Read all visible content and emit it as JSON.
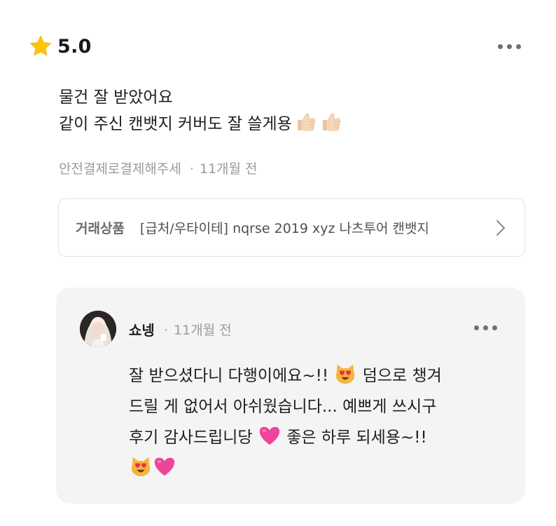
{
  "review": {
    "rating": "5.0",
    "icons": {
      "rating": "star-icon",
      "more": "more-horizontal-icon"
    },
    "text_lines": [
      "물건 잘 받았어요",
      "같이 주신 캔뱃지 커버도 잘 쓸게용"
    ],
    "trailing_emoji": [
      "thumbs-up",
      "thumbs-up"
    ],
    "author": "안전결제로결제해주세",
    "separator": "·",
    "time": "11개월 전"
  },
  "product": {
    "label": "거래상품",
    "name": "[급처/우타이테] nqrse 2019 xyz 나츠투어 캔뱃지"
  },
  "reply": {
    "author": "쇼넹",
    "separator": "·",
    "time": "11개월 전",
    "lines": [
      {
        "text_before": "잘 받으셨다니 다행이에요~!! ",
        "emoji": "heart-eyes-cat",
        "text_after": " 덤으로 챙겨"
      },
      {
        "text_before": "드릴 게 없어서 아쉬웠습니다... 예쁘게 쓰시구"
      },
      {
        "text_before": "후기 감사드립니당 ",
        "emoji": "pink-heart",
        "text_after": " 좋은 하루 되세용~!!"
      }
    ],
    "final_emoji": [
      "heart-eyes-cat",
      "pink-heart"
    ]
  },
  "colors": {
    "star": "#FFC40C",
    "heart": "#F0449A",
    "reply_bg": "#F4F4F5"
  }
}
